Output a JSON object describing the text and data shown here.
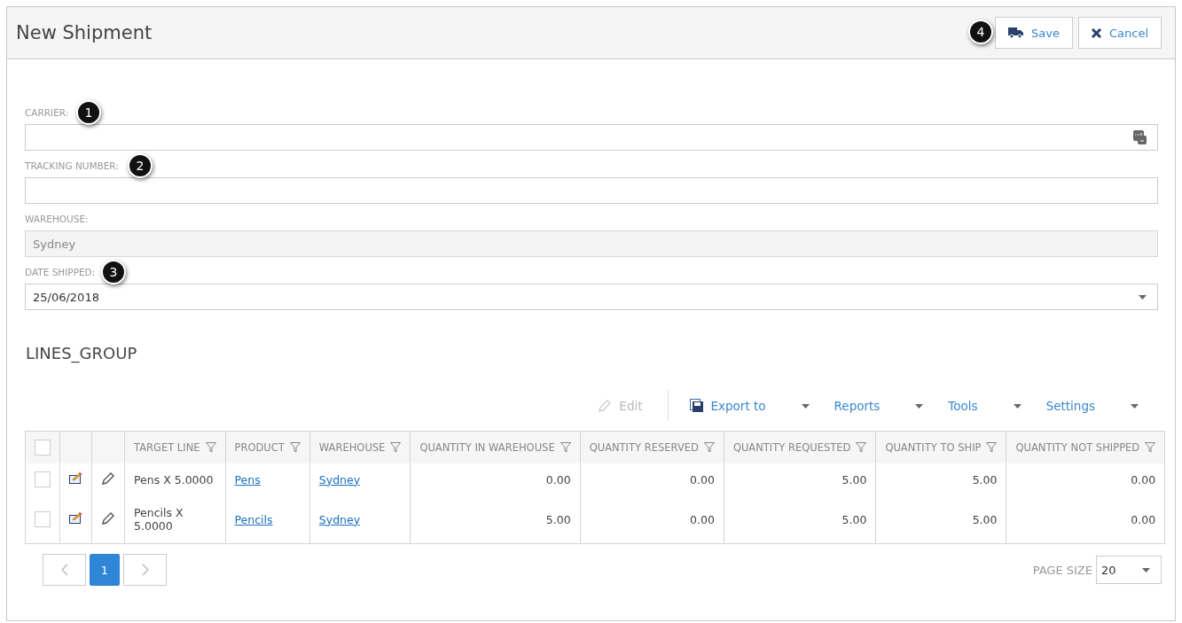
{
  "header": {
    "title": "New Shipment",
    "buttons": [
      {
        "label": "Save",
        "kind": "save",
        "callout": "4"
      },
      {
        "label": "Cancel",
        "kind": "cancel"
      }
    ]
  },
  "fields": [
    {
      "label": "CARRIER:",
      "kind": "lookup",
      "disabled": false,
      "callout": "1"
    },
    {
      "label": "TRACKING NUMBER:",
      "kind": "text",
      "disabled": false,
      "callout": "2"
    },
    {
      "label": "WAREHOUSE:",
      "kind": "text",
      "value": "Sydney",
      "disabled": true
    },
    {
      "label": "DATE SHIPPED:",
      "kind": "dropdown",
      "value": "25/06/2018",
      "disabled": false,
      "callout": "3"
    }
  ],
  "group_title": "LINES_GROUP",
  "toolbar": [
    {
      "label": "Edit",
      "kind": "edit",
      "disabled": true
    },
    {
      "label": "Export to",
      "kind": "export",
      "disabled": false
    },
    {
      "label": "Reports",
      "kind": "menu",
      "disabled": false
    },
    {
      "label": "Tools",
      "kind": "menu",
      "disabled": false
    },
    {
      "label": "Settings",
      "kind": "menu",
      "disabled": false
    }
  ],
  "table": {
    "select_all_checked": false,
    "columns": [
      "TARGET LINE",
      "PRODUCT",
      "WAREHOUSE",
      "QUANTITY IN WAREHOUSE",
      "QUANTITY RESERVED",
      "QUANTITY REQUESTED",
      "QUANTITY TO SHIP",
      "QUANTITY NOT SHIPPED"
    ],
    "rows": [
      {
        "checked": false,
        "target_line": "Pens X 5.0000",
        "product": "Pens",
        "warehouse": "Sydney",
        "quantity_in_warehouse": "0.00",
        "quantity_reserved": "0.00",
        "quantity_requested": "5.00",
        "quantity_to_ship": "5.00",
        "quantity_not_shipped": "0.00"
      },
      {
        "checked": false,
        "target_line": "Pencils X 5.0000",
        "product": "Pencils",
        "warehouse": "Sydney",
        "quantity_in_warehouse": "5.00",
        "quantity_reserved": "0.00",
        "quantity_requested": "5.00",
        "quantity_to_ship": "5.00",
        "quantity_not_shipped": "0.00"
      }
    ]
  },
  "pager": {
    "pages": [
      {
        "label": "1",
        "selected": true
      }
    ],
    "page_size_label": "PAGE SIZE",
    "page_size": "20"
  }
}
